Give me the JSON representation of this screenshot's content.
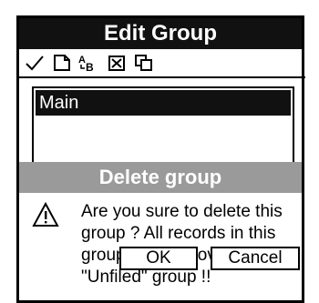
{
  "window": {
    "title": "Edit Group"
  },
  "toolbar": {
    "icons": [
      "check-icon",
      "new-record-icon",
      "rename-abc-icon",
      "delete-icon",
      "copy-icon"
    ]
  },
  "group_list": {
    "items": [
      "Main"
    ]
  },
  "dialog": {
    "title": "Delete group",
    "message": "Are you sure to delete this group ? All records in this group will be moved to the \"Unfiled\" group !!",
    "ok_label": "OK",
    "cancel_label": "Cancel"
  },
  "colors": {
    "titlebar": "#111111",
    "dialog_title": "#9a9a9a",
    "selection": "#111111"
  }
}
